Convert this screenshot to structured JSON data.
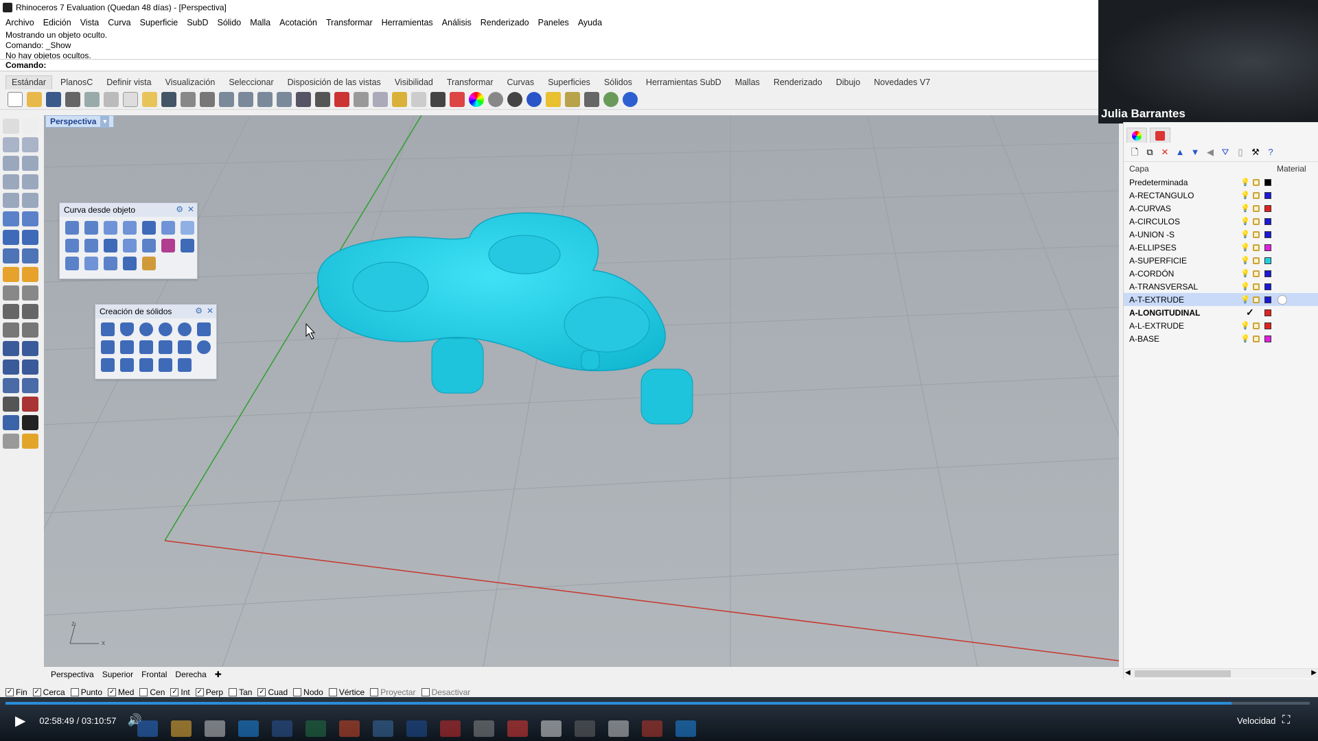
{
  "window": {
    "title": "Rhinoceros 7 Evaluation (Quedan 48 días) - [Perspectiva]"
  },
  "menu": [
    "Archivo",
    "Edición",
    "Vista",
    "Curva",
    "Superficie",
    "SubD",
    "Sólido",
    "Malla",
    "Acotación",
    "Transformar",
    "Herramientas",
    "Análisis",
    "Renderizado",
    "Paneles",
    "Ayuda"
  ],
  "command_history": [
    "Mostrando un objeto oculto.",
    "Comando: _Show",
    "No hay objetos ocultos."
  ],
  "command_prompt": "Comando:",
  "toolbar_tabs": [
    "Estándar",
    "PlanosC",
    "Definir vista",
    "Visualización",
    "Seleccionar",
    "Disposición de las vistas",
    "Visibilidad",
    "Transformar",
    "Curvas",
    "Superficies",
    "Sólidos",
    "Herramientas SubD",
    "Mallas",
    "Renderizado",
    "Dibujo",
    "Novedades V7"
  ],
  "active_toolbar_tab": "Estándar",
  "viewport": {
    "label": "Perspectiva",
    "object_color": "#20d0e8",
    "background": "#a8aeb4"
  },
  "viewport_tabs": [
    "Perspectiva",
    "Superior",
    "Frontal",
    "Derecha"
  ],
  "floating_panels": {
    "curve_from_object": {
      "title": "Curva desde objeto"
    },
    "solid_creation": {
      "title": "Creación de sólidos"
    }
  },
  "webcam": {
    "name": "Julia Barrantes"
  },
  "layers_panel": {
    "column_layer": "Capa",
    "column_material": "Material",
    "layers": [
      {
        "name": "Predeterminada",
        "color": "#000000"
      },
      {
        "name": "A-RECTANGULO",
        "color": "#1a1ad8"
      },
      {
        "name": "A-CURVAS",
        "color": "#e32020"
      },
      {
        "name": "A-CIRCULOS",
        "color": "#1a1ad8"
      },
      {
        "name": "A-UNION -S",
        "color": "#1a1ad8"
      },
      {
        "name": "A-ELLIPSES",
        "color": "#e020e0"
      },
      {
        "name": "A-SUPERFICIE",
        "color": "#20d0e0"
      },
      {
        "name": "A-CORDÓN",
        "color": "#1a1ad8"
      },
      {
        "name": "A-TRANSVERSAL",
        "color": "#1a1ad8"
      },
      {
        "name": "A-T-EXTRUDE",
        "color": "#1a1ad8"
      },
      {
        "name": "A-LONGITUDINAL",
        "color": "#e32020"
      },
      {
        "name": "A-L-EXTRUDE",
        "color": "#e32020"
      },
      {
        "name": "A-BASE",
        "color": "#e020e0"
      }
    ]
  },
  "osnaps": [
    {
      "label": "Fin",
      "checked": true
    },
    {
      "label": "Cerca",
      "checked": true
    },
    {
      "label": "Punto",
      "checked": false
    },
    {
      "label": "Med",
      "checked": true
    },
    {
      "label": "Cen",
      "checked": false
    },
    {
      "label": "Int",
      "checked": true
    },
    {
      "label": "Perp",
      "checked": true
    },
    {
      "label": "Tan",
      "checked": false
    },
    {
      "label": "Cuad",
      "checked": true
    },
    {
      "label": "Nodo",
      "checked": false
    },
    {
      "label": "Vértice",
      "checked": false
    },
    {
      "label": "Proyectar",
      "checked": false
    },
    {
      "label": "Desactivar",
      "checked": false
    }
  ],
  "player": {
    "time": "02:58:49 / 03:10:57",
    "speed_label": "Velocidad",
    "progress_fraction": 0.94
  }
}
